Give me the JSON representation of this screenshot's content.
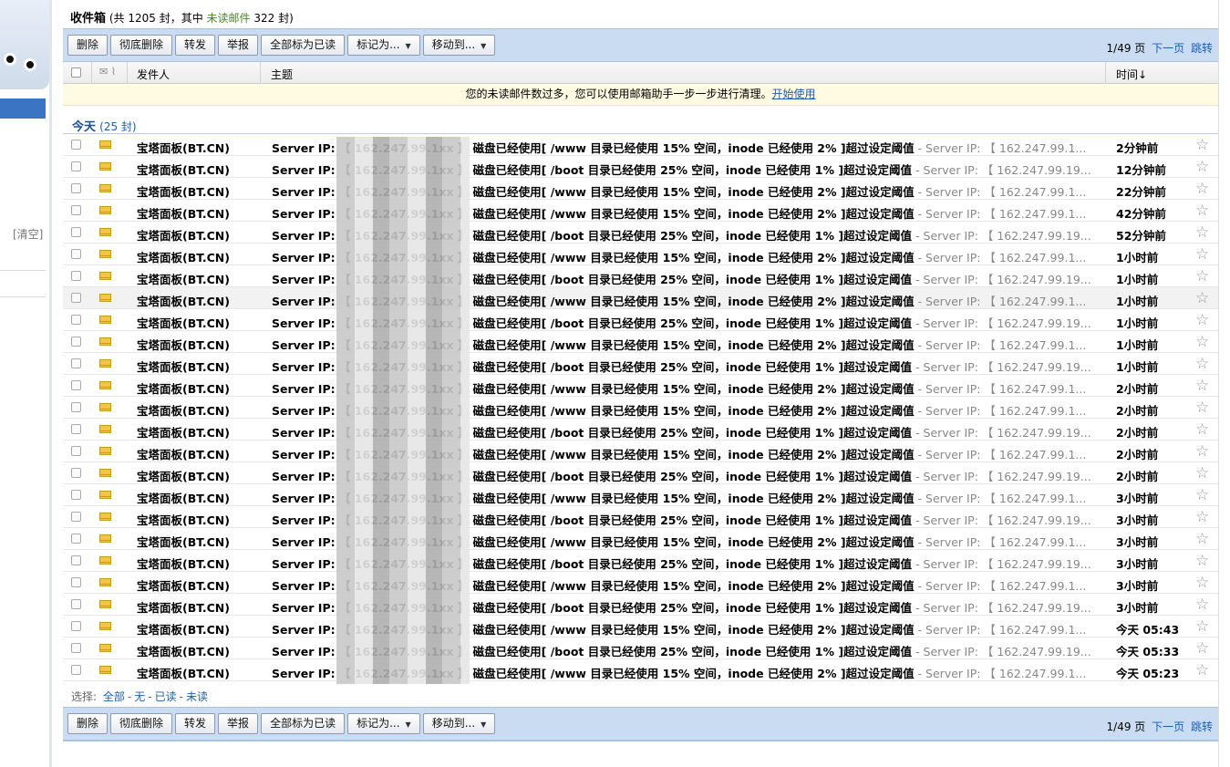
{
  "header": {
    "title": "收件箱",
    "summary_pre": "(共 1205 封，其中",
    "unread_label": "未读邮件",
    "summary_post": "322 封)"
  },
  "toolbar": {
    "delete": "删除",
    "delete_perm": "彻底删除",
    "forward": "转发",
    "report": "举报",
    "mark_all_read": "全部标为已读",
    "mark_as": "标记为...",
    "move_to": "移动到...",
    "page_info": "1/49 页",
    "next_page": "下一页",
    "jump": "跳转"
  },
  "columns": {
    "from": "发件人",
    "subject": "主题",
    "time": "时间↓"
  },
  "notice": {
    "text": "您的未读邮件数过多，您可以使用邮箱助手一步一步进行清理。",
    "link": "开始使用"
  },
  "group": {
    "label": "今天",
    "count": "(25 封)"
  },
  "sidebar": {
    "clear": "[清空]"
  },
  "selection": {
    "label": "选择:",
    "all": "全部",
    "none": "无",
    "read": "已读",
    "unread": "未读"
  },
  "mail_rows": [
    {
      "from": "宝塔面板(BT.CN)",
      "subject": "Server IP: 【 162.247.99.1xx 】 磁盘已经使用[ /www 目录已经使用 15% 空间，inode 已经使用 2% ]超过设定阈值",
      "preview": " - Server IP: 【 162.247.99.1...",
      "time": "2分钟前"
    },
    {
      "from": "宝塔面板(BT.CN)",
      "subject": "Server IP: 【 162.247.99.1xx 】 磁盘已经使用[ /boot 目录已经使用 25% 空间，inode 已经使用 1% ]超过设定阈值",
      "preview": " - Server IP: 【 162.247.99.19...",
      "time": "12分钟前"
    },
    {
      "from": "宝塔面板(BT.CN)",
      "subject": "Server IP: 【 162.247.99.1xx 】 磁盘已经使用[ /www 目录已经使用 15% 空间，inode 已经使用 2% ]超过设定阈值",
      "preview": " - Server IP: 【 162.247.99.1...",
      "time": "22分钟前"
    },
    {
      "from": "宝塔面板(BT.CN)",
      "subject": "Server IP: 【 162.247.99.1xx 】 磁盘已经使用[ /www 目录已经使用 15% 空间，inode 已经使用 2% ]超过设定阈值",
      "preview": " - Server IP: 【 162.247.99.1...",
      "time": "42分钟前"
    },
    {
      "from": "宝塔面板(BT.CN)",
      "subject": "Server IP: 【 162.247.99.1xx 】 磁盘已经使用[ /boot 目录已经使用 25% 空间，inode 已经使用 1% ]超过设定阈值",
      "preview": " - Server IP: 【 162.247.99.19...",
      "time": "52分钟前"
    },
    {
      "from": "宝塔面板(BT.CN)",
      "subject": "Server IP: 【 162.247.99.1xx 】 磁盘已经使用[ /www 目录已经使用 15% 空间，inode 已经使用 2% ]超过设定阈值",
      "preview": " - Server IP: 【 162.247.99.1...",
      "time": "1小时前"
    },
    {
      "from": "宝塔面板(BT.CN)",
      "subject": "Server IP: 【 162.247.99.1xx 】 磁盘已经使用[ /boot 目录已经使用 25% 空间，inode 已经使用 1% ]超过设定阈值",
      "preview": " - Server IP: 【 162.247.99.19...",
      "time": "1小时前"
    },
    {
      "from": "宝塔面板(BT.CN)",
      "subject": "Server IP: 【 162.247.99.1xx 】 磁盘已经使用[ /www 目录已经使用 15% 空间，inode 已经使用 2% ]超过设定阈值",
      "preview": " - Server IP: 【 162.247.99.1...",
      "time": "1小时前"
    },
    {
      "from": "宝塔面板(BT.CN)",
      "subject": "Server IP: 【 162.247.99.1xx 】 磁盘已经使用[ /boot 目录已经使用 25% 空间，inode 已经使用 1% ]超过设定阈值",
      "preview": " - Server IP: 【 162.247.99.19...",
      "time": "1小时前"
    },
    {
      "from": "宝塔面板(BT.CN)",
      "subject": "Server IP: 【 162.247.99.1xx 】 磁盘已经使用[ /www 目录已经使用 15% 空间，inode 已经使用 2% ]超过设定阈值",
      "preview": " - Server IP: 【 162.247.99.1...",
      "time": "1小时前"
    },
    {
      "from": "宝塔面板(BT.CN)",
      "subject": "Server IP: 【 162.247.99.1xx 】 磁盘已经使用[ /boot 目录已经使用 25% 空间，inode 已经使用 1% ]超过设定阈值",
      "preview": " - Server IP: 【 162.247.99.19...",
      "time": "1小时前"
    },
    {
      "from": "宝塔面板(BT.CN)",
      "subject": "Server IP: 【 162.247.99.1xx 】 磁盘已经使用[ /www 目录已经使用 15% 空间，inode 已经使用 2% ]超过设定阈值",
      "preview": " - Server IP: 【 162.247.99.1...",
      "time": "2小时前"
    },
    {
      "from": "宝塔面板(BT.CN)",
      "subject": "Server IP: 【 162.247.99.1xx 】 磁盘已经使用[ /www 目录已经使用 15% 空间，inode 已经使用 2% ]超过设定阈值",
      "preview": " - Server IP: 【 162.247.99.1...",
      "time": "2小时前"
    },
    {
      "from": "宝塔面板(BT.CN)",
      "subject": "Server IP: 【 162.247.99.1xx 】 磁盘已经使用[ /boot 目录已经使用 25% 空间，inode 已经使用 1% ]超过设定阈值",
      "preview": " - Server IP: 【 162.247.99.19...",
      "time": "2小时前"
    },
    {
      "from": "宝塔面板(BT.CN)",
      "subject": "Server IP: 【 162.247.99.1xx 】 磁盘已经使用[ /www 目录已经使用 15% 空间，inode 已经使用 2% ]超过设定阈值",
      "preview": " - Server IP: 【 162.247.99.1...",
      "time": "2小时前"
    },
    {
      "from": "宝塔面板(BT.CN)",
      "subject": "Server IP: 【 162.247.99.1xx 】 磁盘已经使用[ /boot 目录已经使用 25% 空间，inode 已经使用 1% ]超过设定阈值",
      "preview": " - Server IP: 【 162.247.99.19...",
      "time": "2小时前"
    },
    {
      "from": "宝塔面板(BT.CN)",
      "subject": "Server IP: 【 162.247.99.1xx 】 磁盘已经使用[ /www 目录已经使用 15% 空间，inode 已经使用 2% ]超过设定阈值",
      "preview": " - Server IP: 【 162.247.99.1...",
      "time": "3小时前"
    },
    {
      "from": "宝塔面板(BT.CN)",
      "subject": "Server IP: 【 162.247.99.1xx 】 磁盘已经使用[ /boot 目录已经使用 25% 空间，inode 已经使用 1% ]超过设定阈值",
      "preview": " - Server IP: 【 162.247.99.19...",
      "time": "3小时前"
    },
    {
      "from": "宝塔面板(BT.CN)",
      "subject": "Server IP: 【 162.247.99.1xx 】 磁盘已经使用[ /www 目录已经使用 15% 空间，inode 已经使用 2% ]超过设定阈值",
      "preview": " - Server IP: 【 162.247.99.1...",
      "time": "3小时前"
    },
    {
      "from": "宝塔面板(BT.CN)",
      "subject": "Server IP: 【 162.247.99.1xx 】 磁盘已经使用[ /boot 目录已经使用 25% 空间，inode 已经使用 1% ]超过设定阈值",
      "preview": " - Server IP: 【 162.247.99.19...",
      "time": "3小时前"
    },
    {
      "from": "宝塔面板(BT.CN)",
      "subject": "Server IP: 【 162.247.99.1xx 】 磁盘已经使用[ /www 目录已经使用 15% 空间，inode 已经使用 2% ]超过设定阈值",
      "preview": " - Server IP: 【 162.247.99.1...",
      "time": "3小时前"
    },
    {
      "from": "宝塔面板(BT.CN)",
      "subject": "Server IP: 【 162.247.99.1xx 】 磁盘已经使用[ /boot 目录已经使用 25% 空间，inode 已经使用 1% ]超过设定阈值",
      "preview": " - Server IP: 【 162.247.99.19...",
      "time": "3小时前"
    },
    {
      "from": "宝塔面板(BT.CN)",
      "subject": "Server IP: 【 162.247.99.1xx 】 磁盘已经使用[ /www 目录已经使用 15% 空间，inode 已经使用 2% ]超过设定阈值",
      "preview": " - Server IP: 【 162.247.99.1...",
      "time": "今天 05:43"
    },
    {
      "from": "宝塔面板(BT.CN)",
      "subject": "Server IP: 【 162.247.99.1xx 】 磁盘已经使用[ /boot 目录已经使用 25% 空间，inode 已经使用 1% ]超过设定阈值",
      "preview": " - Server IP: 【 162.247.99.19...",
      "time": "今天 05:33"
    },
    {
      "from": "宝塔面板(BT.CN)",
      "subject": "Server IP: 【 162.247.99.1xx 】 磁盘已经使用[ /www 目录已经使用 15% 空间，inode 已经使用 2% ]超过设定阈值",
      "preview": " - Server IP: 【 162.247.99.1...",
      "time": "今天 05:23"
    }
  ],
  "colors": {
    "toolbar_bg": "#c9dcf2",
    "unread_green": "#4a8a1e",
    "link_blue": "#1a5fb4",
    "notice_bg": "#fffbe3"
  }
}
